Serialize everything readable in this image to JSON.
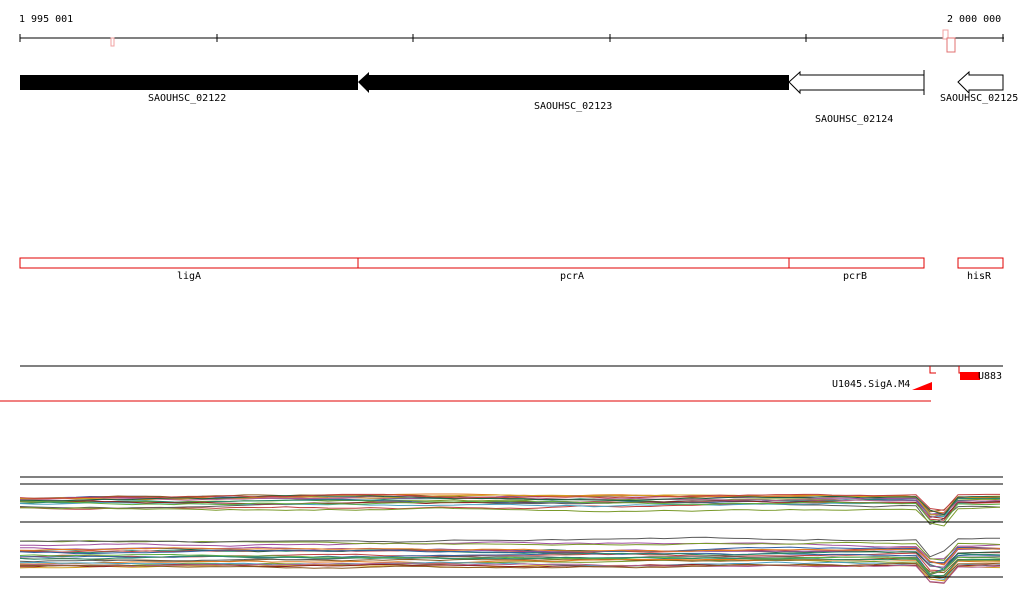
{
  "ruler": {
    "start_label": "1 995 001",
    "end_label": "2 000 000",
    "start": 1995001,
    "end": 2000000
  },
  "genes": [
    {
      "id": "SAOUHSC_02122",
      "label": "SAOUHSC_02122",
      "strand": "-",
      "fill": "black"
    },
    {
      "id": "SAOUHSC_02123",
      "label": "SAOUHSC_02123",
      "strand": "-",
      "fill": "black"
    },
    {
      "id": "SAOUHSC_02124",
      "label": "SAOUHSC_02124",
      "strand": "-",
      "fill": "white"
    },
    {
      "id": "SAOUHSC_02125",
      "label": "SAOUHSC_02125",
      "strand": "-",
      "fill": "white"
    }
  ],
  "gene_names": [
    {
      "id": "ligA",
      "label": "ligA"
    },
    {
      "id": "pcrA",
      "label": "pcrA"
    },
    {
      "id": "pcrB",
      "label": "pcrB"
    },
    {
      "id": "hisR",
      "label": "hisR"
    }
  ],
  "regulatory": {
    "label_1": "U1045.SigA.M4",
    "label_2": "U883"
  },
  "colors": {
    "gene_strong": "#000000",
    "gene_weak": "#ffffff",
    "annotation_box": "#e00000",
    "promoter": "#ff0000",
    "axis": "#000000"
  }
}
